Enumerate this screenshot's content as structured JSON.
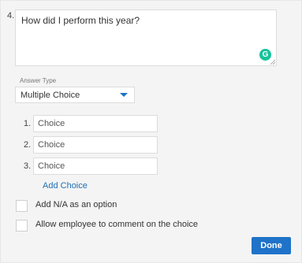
{
  "question": {
    "number": "4.",
    "text": "How did I perform this year?",
    "grammarly_badge": "G"
  },
  "answer_type": {
    "label": "Answer Type",
    "selected": "Multiple Choice"
  },
  "choices": [
    {
      "number": "1.",
      "placeholder": "Choice"
    },
    {
      "number": "2.",
      "placeholder": "Choice"
    },
    {
      "number": "3.",
      "placeholder": "Choice"
    }
  ],
  "add_choice_label": "Add Choice",
  "options": [
    {
      "label": "Add N/A as an option",
      "checked": false
    },
    {
      "label": "Allow employee to comment on the choice",
      "checked": false
    }
  ],
  "done_label": "Done",
  "colors": {
    "accent": "#1f73c9",
    "link": "#1f6fb5",
    "grammarly": "#15c39a"
  }
}
